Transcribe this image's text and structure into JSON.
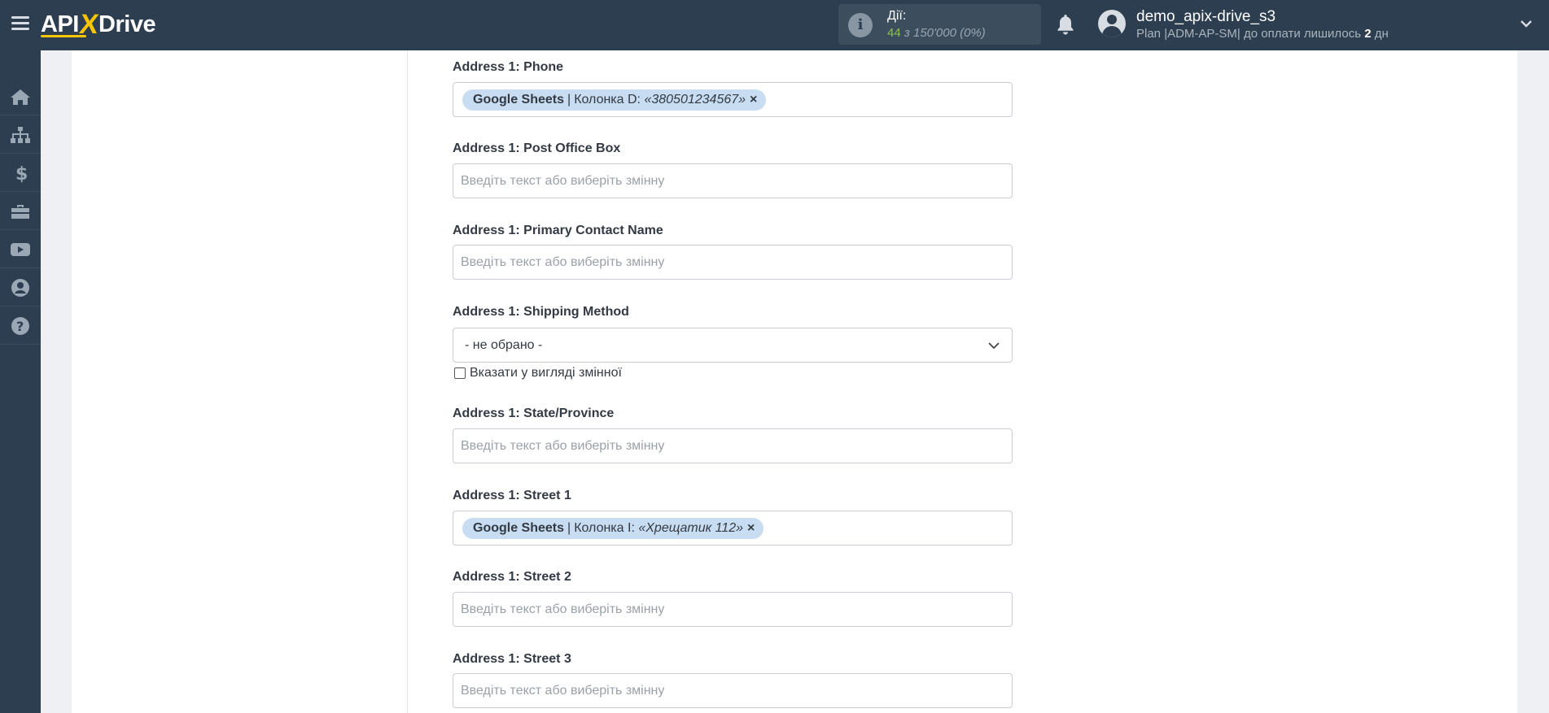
{
  "header": {
    "logo": {
      "part1": "API",
      "x": "X",
      "part2": "Drive"
    },
    "actions": {
      "label": "Дії:",
      "count": "44",
      "of_total": "з 150'000",
      "percent": "(0%)"
    },
    "user": {
      "name": "demo_apix-drive_s3",
      "plan_text": "Plan |ADM-AP-SM| до оплати лишилось",
      "days_num": "2",
      "days_unit": "дн"
    }
  },
  "sidebar": {
    "items": [
      "home-icon",
      "sitemap-icon",
      "dollar-icon",
      "briefcase-icon",
      "youtube-icon",
      "user-icon",
      "help-icon"
    ]
  },
  "form": {
    "phone": {
      "label": "Address 1: Phone",
      "tag": {
        "source": "Google Sheets",
        "sep": "|",
        "column": "Колонка D:",
        "value": "«380501234567»",
        "remove": "×"
      }
    },
    "po_box": {
      "label": "Address 1: Post Office Box",
      "placeholder": "Введіть текст або виберіть змінну"
    },
    "primary_contact": {
      "label": "Address 1: Primary Contact Name",
      "placeholder": "Введіть текст або виберіть змінну"
    },
    "shipping": {
      "label": "Address 1: Shipping Method",
      "value": "- не обрано -",
      "checkbox_label": "Вказати у вигляді змінної"
    },
    "state": {
      "label": "Address 1: State/Province",
      "placeholder": "Введіть текст або виберіть змінну"
    },
    "street1": {
      "label": "Address 1: Street 1",
      "tag": {
        "source": "Google Sheets",
        "sep": "|",
        "column": "Колонка I:",
        "value": "«Хрещатик 112»",
        "remove": "×"
      }
    },
    "street2": {
      "label": "Address 1: Street 2",
      "placeholder": "Введіть текст або виберіть змінну"
    },
    "street3": {
      "label": "Address 1: Street 3",
      "placeholder": "Введіть текст або виберіть змінну"
    }
  }
}
